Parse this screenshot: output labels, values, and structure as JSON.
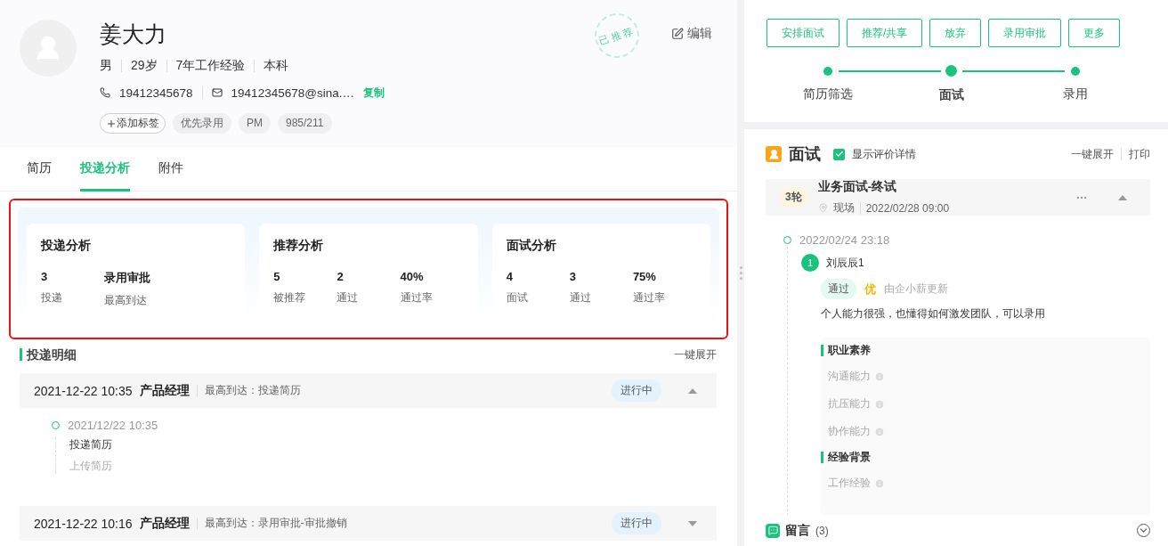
{
  "candidate": {
    "name": "姜大力",
    "stamp": "已推荐",
    "edit": "编辑",
    "facts": [
      "男",
      "29岁",
      "7年工作经验",
      "本科"
    ],
    "phone": "19412345678",
    "email": "19412345678@sina.…",
    "copy": "复制",
    "add_tag": "添加标签",
    "tags": [
      "优先录用",
      "PM",
      "985/211"
    ]
  },
  "tabs": [
    {
      "label": "简历",
      "selected": false
    },
    {
      "label": "投递分析",
      "selected": true
    },
    {
      "label": "附件",
      "selected": false
    }
  ],
  "analysis": [
    {
      "title": "投递分析",
      "stats": [
        {
          "value": "3",
          "label": "投递"
        },
        {
          "value": "录用审批",
          "label": "最高到达"
        }
      ]
    },
    {
      "title": "推荐分析",
      "stats": [
        {
          "value": "5",
          "label": "被推荐"
        },
        {
          "value": "2",
          "label": "通过"
        },
        {
          "value": "40%",
          "label": "通过率"
        }
      ]
    },
    {
      "title": "面试分析",
      "stats": [
        {
          "value": "4",
          "label": "面试"
        },
        {
          "value": "3",
          "label": "通过"
        },
        {
          "value": "75%",
          "label": "通过率"
        }
      ]
    }
  ],
  "details": {
    "title": "投递明细",
    "expand_all": "一键展开",
    "records": [
      {
        "time": "2021-12-22 10:35",
        "position": "产品经理",
        "reached": "最高到达：投递简历",
        "status": "进行中",
        "expanded": true,
        "events": [
          {
            "time": "2021/12/22 10:35",
            "title": "投递简历",
            "note": "上传简历"
          }
        ]
      },
      {
        "time": "2021-12-22 10:16",
        "position": "产品经理",
        "reached": "最高到达：录用审批-审批撤销",
        "status": "进行中",
        "expanded": false
      }
    ]
  },
  "actions": [
    "安排面试",
    "推荐/共享",
    "放弃",
    "录用审批",
    "更多"
  ],
  "stages": [
    {
      "label": "简历筛选",
      "selected": false
    },
    {
      "label": "面试",
      "selected": true
    },
    {
      "label": "录用",
      "selected": false
    }
  ],
  "interview": {
    "title": "面试",
    "show_details": {
      "label": "显示评价详情",
      "checked": true
    },
    "expand_all": "一键展开",
    "print": "打印",
    "round": {
      "badge": "3轮",
      "name": "业务面试-终试",
      "place": "现场",
      "time": "2022/02/28 09:00",
      "expanded": true
    },
    "feedback": {
      "time": "2022/02/24 23:18",
      "index": "1",
      "interviewer": "刘辰辰1",
      "result": "通过",
      "grade": "优",
      "updated_by": "由企小薪更新",
      "comment": "个人能力很强，也懂得如何激发团队，可以录用",
      "sections": [
        {
          "title": "职业素养",
          "items": [
            "沟通能力",
            "抗压能力",
            "协作能力"
          ]
        },
        {
          "title": "经验背景",
          "items": [
            "工作经验"
          ]
        }
      ]
    }
  },
  "comments": {
    "title": "留言",
    "count": "(3)",
    "expanded": false
  }
}
